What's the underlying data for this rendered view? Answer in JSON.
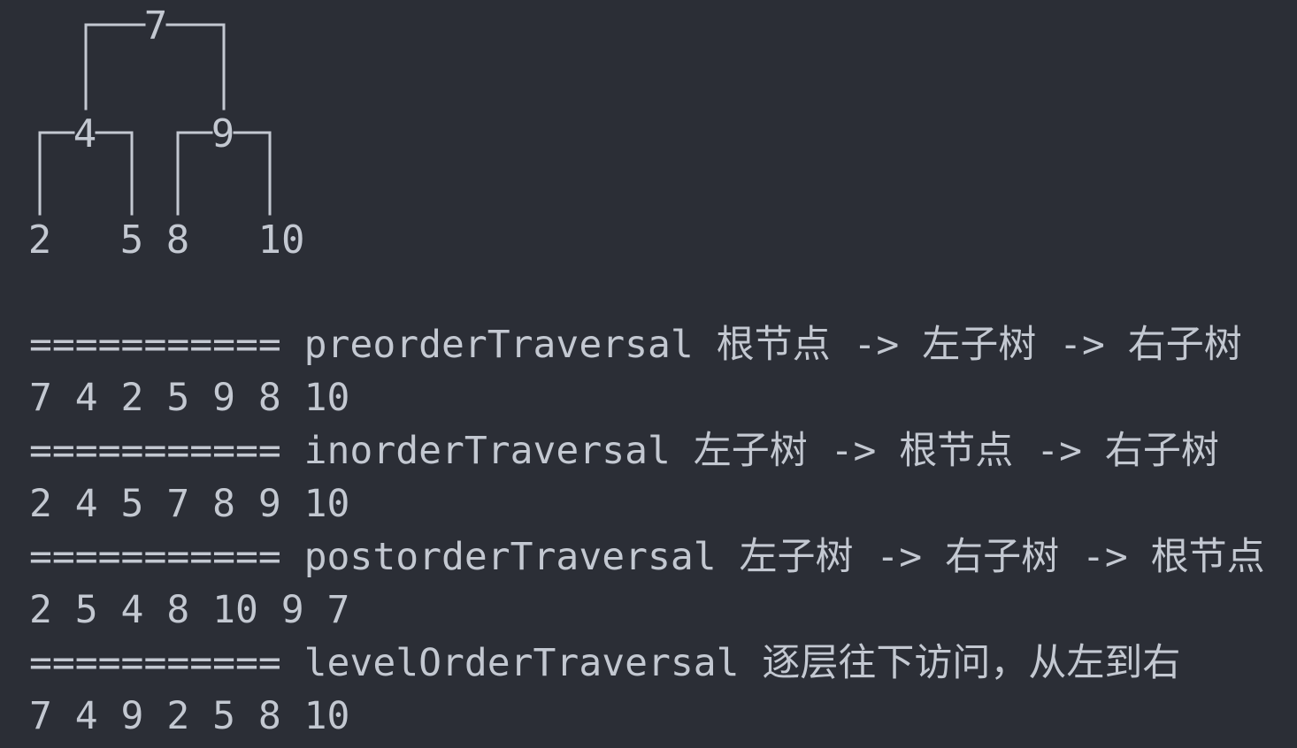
{
  "tree": {
    "root": "7",
    "level2": [
      "4",
      "9"
    ],
    "leaves": [
      "2",
      "5",
      "8",
      "10"
    ]
  },
  "output_lines": [
    "=========== preorderTraversal 根节点 -> 左子树 -> 右子树",
    "7 4 2 5 9 8 10",
    "=========== inorderTraversal 左子树 -> 根节点 -> 右子树",
    "2 4 5 7 8 9 10",
    "=========== postorderTraversal 左子树 -> 右子树 -> 根节点",
    "2 5 4 8 10 9 7",
    "=========== levelOrderTraversal 逐层往下访问，从左到右",
    "7 4 9 2 5 8 10"
  ],
  "colors": {
    "background": "#2b2e36",
    "text": "#c3c8d1"
  }
}
